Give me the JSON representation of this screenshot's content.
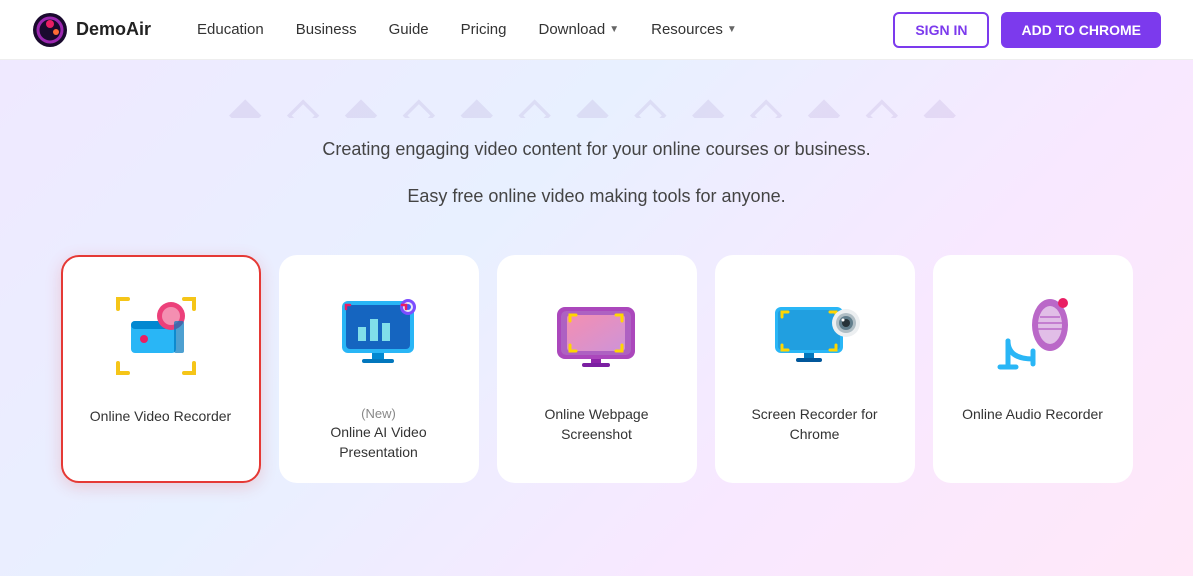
{
  "brand": {
    "name": "DemoAir",
    "logo_colors": [
      "#9c27b0",
      "#e91e63",
      "#ff5722"
    ]
  },
  "navbar": {
    "logo_text": "DemoAir",
    "links": [
      {
        "label": "Education",
        "has_dropdown": false
      },
      {
        "label": "Business",
        "has_dropdown": false
      },
      {
        "label": "Guide",
        "has_dropdown": false
      },
      {
        "label": "Pricing",
        "has_dropdown": false
      },
      {
        "label": "Download",
        "has_dropdown": true
      },
      {
        "label": "Resources",
        "has_dropdown": true
      }
    ],
    "sign_in_label": "SIGN IN",
    "add_chrome_label": "ADD TO CHROME"
  },
  "hero": {
    "blurred_text": "● ○ ● ○ ● ○ ● ○ ● ○",
    "line1": "Creating engaging video content for your online courses or business.",
    "line2": "Easy free online video making tools for anyone."
  },
  "cards": [
    {
      "id": "online-video-recorder",
      "label": "Online Video Recorder",
      "new_badge": "",
      "selected": true
    },
    {
      "id": "ai-video-presentation",
      "label": "Online AI Video Presentation",
      "new_badge": "(New)",
      "selected": false
    },
    {
      "id": "online-webpage-screenshot",
      "label": "Online Webpage Screenshot",
      "new_badge": "",
      "selected": false
    },
    {
      "id": "screen-recorder-chrome",
      "label": "Screen Recorder for Chrome",
      "new_badge": "",
      "selected": false
    },
    {
      "id": "online-audio-recorder",
      "label": "Online Audio Recorder",
      "new_badge": "",
      "selected": false
    }
  ]
}
